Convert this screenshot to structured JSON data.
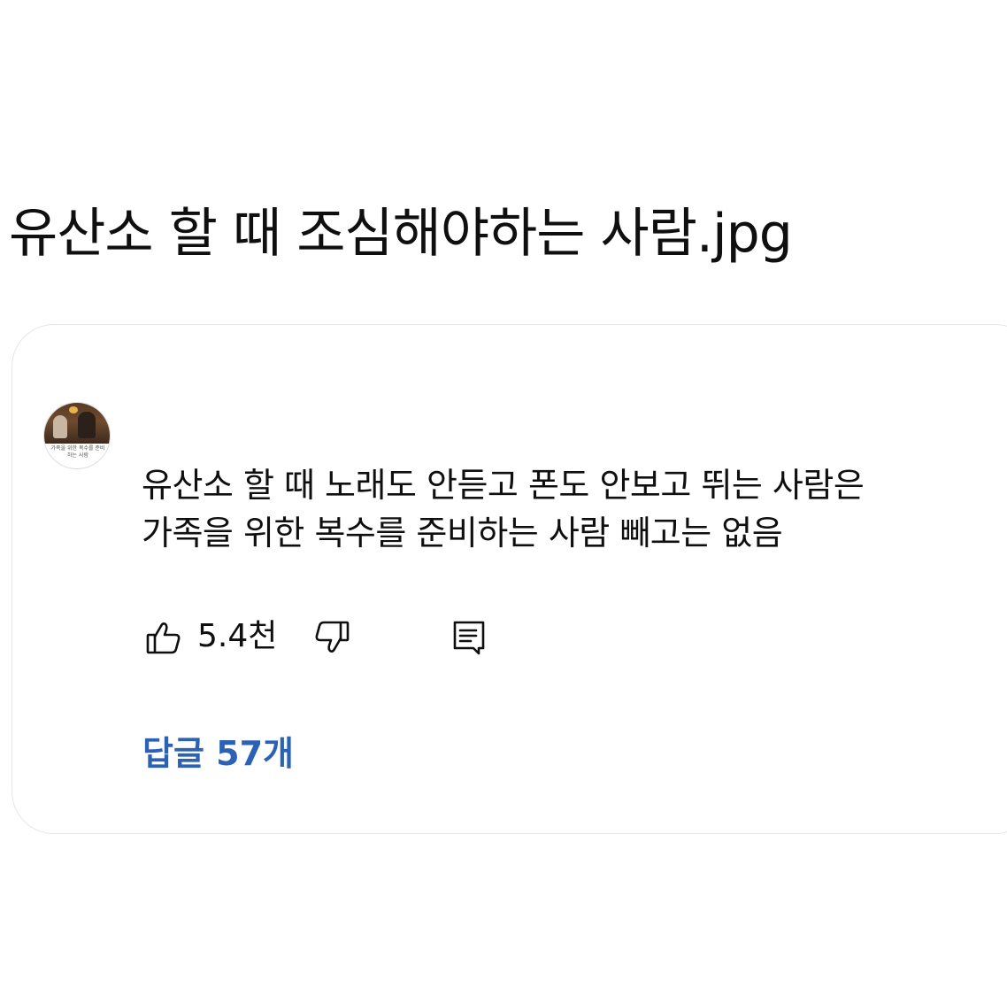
{
  "post": {
    "title": "유산소 할 때 조심해야하는 사람.jpg"
  },
  "comment": {
    "avatar_caption": "가족을 위한 복수를 준비하는 사람",
    "lines": [
      "유산소 할 때 노래도 안듣고 폰도 안보고 뛰는 사람은",
      "가족을 위한 복수를 준비하는 사람 빼고는 없음"
    ],
    "like_count": "5.4천",
    "replies_label": "답글 57개"
  },
  "icons": {
    "like": "thumbs-up-icon",
    "dislike": "thumbs-down-icon",
    "reply": "comment-reply-icon"
  },
  "colors": {
    "replies_link": "#2b62b4",
    "text": "#0f0f0f",
    "card_border": "#e6e6e6"
  }
}
